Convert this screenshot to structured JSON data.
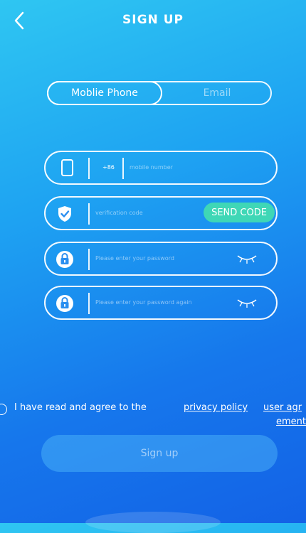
{
  "header": {
    "title": "SIGN UP"
  },
  "tabs": [
    {
      "label": "Moblie Phone",
      "active": true
    },
    {
      "label": "Email",
      "active": false
    }
  ],
  "form": {
    "phone": {
      "prefix": "+86",
      "placeholder": "mobile number"
    },
    "code": {
      "placeholder": "verification code",
      "send_label": "SEND CODE"
    },
    "password": {
      "placeholder": "Please enter your password"
    },
    "password_again": {
      "placeholder": "Please enter your password again"
    }
  },
  "agreement": {
    "text": "I have read and agree to the",
    "privacy_link": "privacy policy",
    "user_link_part1": "user agr",
    "user_link_part2": "ement"
  },
  "signup_label": "Sign up",
  "colors": {
    "accent": "#3fd7b6",
    "background_top": "#2fc6f2",
    "background_bottom": "#1362e6"
  }
}
